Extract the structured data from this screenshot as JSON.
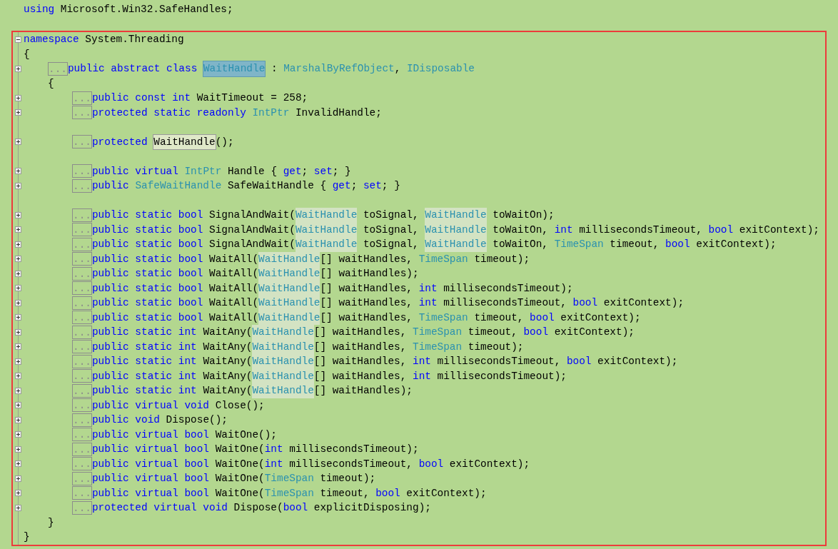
{
  "code": [
    {
      "kind": "code",
      "tokens": [
        {
          "text": "using ",
          "kind": "keyword"
        },
        {
          "text": "Microsoft.Win32.SafeHandles;",
          "kind": "plain"
        }
      ]
    },
    {
      "kind": "blank"
    }
  ],
  "annotated_code": [
    {
      "kind": "code",
      "collapsed": false,
      "tokens": [
        {
          "text": "namespace ",
          "kind": "keyword"
        },
        {
          "text": "System.Threading",
          "kind": "plain"
        }
      ],
      "open": "{",
      "close": "}",
      "children": [
        {
          "kind": "code",
          "collapsed": true,
          "ellipsis": "...",
          "tokens": [
            {
              "text": "public abstract class ",
              "kind": "keyword"
            },
            {
              "text": "WaitHandle",
              "kind": "type",
              "selected": true
            },
            {
              "text": " : ",
              "kind": "plain"
            },
            {
              "text": "MarshalByRefObject",
              "kind": "type"
            },
            {
              "text": ", ",
              "kind": "plain"
            },
            {
              "text": "IDisposable",
              "kind": "type"
            }
          ],
          "open": "{",
          "close": "}",
          "children": [
            {
              "kind": "code",
              "collapsed": true,
              "ellipsis": "...",
              "tokens": [
                {
                  "text": "public const int ",
                  "kind": "keyword"
                },
                {
                  "text": "WaitTimeout = 258;",
                  "kind": "plain"
                }
              ]
            },
            {
              "kind": "code",
              "collapsed": true,
              "ellipsis": "...",
              "tokens": [
                {
                  "text": "protected static readonly ",
                  "kind": "keyword"
                },
                {
                  "text": "IntPtr",
                  "kind": "type"
                },
                {
                  "text": " InvalidHandle;",
                  "kind": "plain"
                }
              ]
            },
            {
              "kind": "blank"
            },
            {
              "kind": "code",
              "collapsed": true,
              "ellipsis": "...",
              "tokens": [
                {
                  "text": "protected ",
                  "kind": "keyword"
                },
                {
                  "text": "WaitHandle",
                  "kind": "plain",
                  "boxed": true
                },
                {
                  "text": "();",
                  "kind": "plain"
                }
              ]
            },
            {
              "kind": "blank"
            },
            {
              "kind": "code",
              "collapsed": true,
              "ellipsis": "...",
              "tokens": [
                {
                  "text": "public virtual ",
                  "kind": "keyword"
                },
                {
                  "text": "IntPtr",
                  "kind": "type"
                },
                {
                  "text": " Handle { ",
                  "kind": "plain"
                },
                {
                  "text": "get",
                  "kind": "keyword"
                },
                {
                  "text": "; ",
                  "kind": "plain"
                },
                {
                  "text": "set",
                  "kind": "keyword"
                },
                {
                  "text": "; }",
                  "kind": "plain"
                }
              ]
            },
            {
              "kind": "code",
              "collapsed": true,
              "ellipsis": "...",
              "tokens": [
                {
                  "text": "public ",
                  "kind": "keyword"
                },
                {
                  "text": "SafeWaitHandle",
                  "kind": "type"
                },
                {
                  "text": " SafeWaitHandle { ",
                  "kind": "plain"
                },
                {
                  "text": "get",
                  "kind": "keyword"
                },
                {
                  "text": "; ",
                  "kind": "plain"
                },
                {
                  "text": "set",
                  "kind": "keyword"
                },
                {
                  "text": "; }",
                  "kind": "plain"
                }
              ]
            },
            {
              "kind": "blank"
            },
            {
              "kind": "code",
              "collapsed": true,
              "ellipsis": "...",
              "tokens": [
                {
                  "text": "public static bool ",
                  "kind": "keyword"
                },
                {
                  "text": "SignalAndWait(",
                  "kind": "plain"
                },
                {
                  "text": "WaitHandle",
                  "kind": "type",
                  "highlighted": true
                },
                {
                  "text": " toSignal, ",
                  "kind": "plain"
                },
                {
                  "text": "WaitHandle",
                  "kind": "type",
                  "highlighted": true
                },
                {
                  "text": " toWaitOn);",
                  "kind": "plain"
                }
              ]
            },
            {
              "kind": "code",
              "collapsed": true,
              "ellipsis": "...",
              "tokens": [
                {
                  "text": "public static bool ",
                  "kind": "keyword"
                },
                {
                  "text": "SignalAndWait(",
                  "kind": "plain"
                },
                {
                  "text": "WaitHandle",
                  "kind": "type",
                  "highlighted": true
                },
                {
                  "text": " toSignal, ",
                  "kind": "plain"
                },
                {
                  "text": "WaitHandle",
                  "kind": "type",
                  "highlighted": true
                },
                {
                  "text": " toWaitOn, ",
                  "kind": "plain"
                },
                {
                  "text": "int",
                  "kind": "keyword"
                },
                {
                  "text": " millisecondsTimeout, ",
                  "kind": "plain"
                },
                {
                  "text": "bool",
                  "kind": "keyword"
                },
                {
                  "text": " exitContext);",
                  "kind": "plain"
                }
              ]
            },
            {
              "kind": "code",
              "collapsed": true,
              "ellipsis": "...",
              "tokens": [
                {
                  "text": "public static bool ",
                  "kind": "keyword"
                },
                {
                  "text": "SignalAndWait(",
                  "kind": "plain"
                },
                {
                  "text": "WaitHandle",
                  "kind": "type",
                  "highlighted": true
                },
                {
                  "text": " toSignal, ",
                  "kind": "plain"
                },
                {
                  "text": "WaitHandle",
                  "kind": "type",
                  "highlighted": true
                },
                {
                  "text": " toWaitOn, ",
                  "kind": "plain"
                },
                {
                  "text": "TimeSpan",
                  "kind": "type"
                },
                {
                  "text": " timeout, ",
                  "kind": "plain"
                },
                {
                  "text": "bool",
                  "kind": "keyword"
                },
                {
                  "text": " exitContext);",
                  "kind": "plain"
                }
              ]
            },
            {
              "kind": "code",
              "collapsed": true,
              "ellipsis": "...",
              "tokens": [
                {
                  "text": "public static bool ",
                  "kind": "keyword"
                },
                {
                  "text": "WaitAll(",
                  "kind": "plain"
                },
                {
                  "text": "WaitHandle",
                  "kind": "type",
                  "highlighted": true
                },
                {
                  "text": "[] waitHandles, ",
                  "kind": "plain"
                },
                {
                  "text": "TimeSpan",
                  "kind": "type"
                },
                {
                  "text": " timeout);",
                  "kind": "plain"
                }
              ]
            },
            {
              "kind": "code",
              "collapsed": true,
              "ellipsis": "...",
              "tokens": [
                {
                  "text": "public static bool ",
                  "kind": "keyword"
                },
                {
                  "text": "WaitAll(",
                  "kind": "plain"
                },
                {
                  "text": "WaitHandle",
                  "kind": "type",
                  "highlighted": true
                },
                {
                  "text": "[] waitHandles);",
                  "kind": "plain"
                }
              ]
            },
            {
              "kind": "code",
              "collapsed": true,
              "ellipsis": "...",
              "tokens": [
                {
                  "text": "public static bool ",
                  "kind": "keyword"
                },
                {
                  "text": "WaitAll(",
                  "kind": "plain"
                },
                {
                  "text": "WaitHandle",
                  "kind": "type",
                  "highlighted": true
                },
                {
                  "text": "[] waitHandles, ",
                  "kind": "plain"
                },
                {
                  "text": "int",
                  "kind": "keyword"
                },
                {
                  "text": " millisecondsTimeout);",
                  "kind": "plain"
                }
              ]
            },
            {
              "kind": "code",
              "collapsed": true,
              "ellipsis": "...",
              "tokens": [
                {
                  "text": "public static bool ",
                  "kind": "keyword"
                },
                {
                  "text": "WaitAll(",
                  "kind": "plain"
                },
                {
                  "text": "WaitHandle",
                  "kind": "type",
                  "highlighted": true
                },
                {
                  "text": "[] waitHandles, ",
                  "kind": "plain"
                },
                {
                  "text": "int",
                  "kind": "keyword"
                },
                {
                  "text": " millisecondsTimeout, ",
                  "kind": "plain"
                },
                {
                  "text": "bool",
                  "kind": "keyword"
                },
                {
                  "text": " exitContext);",
                  "kind": "plain"
                }
              ]
            },
            {
              "kind": "code",
              "collapsed": true,
              "ellipsis": "...",
              "tokens": [
                {
                  "text": "public static bool ",
                  "kind": "keyword"
                },
                {
                  "text": "WaitAll(",
                  "kind": "plain"
                },
                {
                  "text": "WaitHandle",
                  "kind": "type",
                  "highlighted": true
                },
                {
                  "text": "[] waitHandles, ",
                  "kind": "plain"
                },
                {
                  "text": "TimeSpan",
                  "kind": "type"
                },
                {
                  "text": " timeout, ",
                  "kind": "plain"
                },
                {
                  "text": "bool",
                  "kind": "keyword"
                },
                {
                  "text": " exitContext);",
                  "kind": "plain"
                }
              ]
            },
            {
              "kind": "code",
              "collapsed": true,
              "ellipsis": "...",
              "tokens": [
                {
                  "text": "public static int ",
                  "kind": "keyword"
                },
                {
                  "text": "WaitAny(",
                  "kind": "plain"
                },
                {
                  "text": "WaitHandle",
                  "kind": "type",
                  "highlighted": true
                },
                {
                  "text": "[] waitHandles, ",
                  "kind": "plain"
                },
                {
                  "text": "TimeSpan",
                  "kind": "type"
                },
                {
                  "text": " timeout, ",
                  "kind": "plain"
                },
                {
                  "text": "bool",
                  "kind": "keyword"
                },
                {
                  "text": " exitContext);",
                  "kind": "plain"
                }
              ]
            },
            {
              "kind": "code",
              "collapsed": true,
              "ellipsis": "...",
              "tokens": [
                {
                  "text": "public static int ",
                  "kind": "keyword"
                },
                {
                  "text": "WaitAny(",
                  "kind": "plain"
                },
                {
                  "text": "WaitHandle",
                  "kind": "type",
                  "highlighted": true
                },
                {
                  "text": "[] waitHandles, ",
                  "kind": "plain"
                },
                {
                  "text": "TimeSpan",
                  "kind": "type"
                },
                {
                  "text": " timeout);",
                  "kind": "plain"
                }
              ]
            },
            {
              "kind": "code",
              "collapsed": true,
              "ellipsis": "...",
              "tokens": [
                {
                  "text": "public static int ",
                  "kind": "keyword"
                },
                {
                  "text": "WaitAny(",
                  "kind": "plain"
                },
                {
                  "text": "WaitHandle",
                  "kind": "type",
                  "highlighted": true
                },
                {
                  "text": "[] waitHandles, ",
                  "kind": "plain"
                },
                {
                  "text": "int",
                  "kind": "keyword"
                },
                {
                  "text": " millisecondsTimeout, ",
                  "kind": "plain"
                },
                {
                  "text": "bool",
                  "kind": "keyword"
                },
                {
                  "text": " exitContext);",
                  "kind": "plain"
                }
              ]
            },
            {
              "kind": "code",
              "collapsed": true,
              "ellipsis": "...",
              "tokens": [
                {
                  "text": "public static int ",
                  "kind": "keyword"
                },
                {
                  "text": "WaitAny(",
                  "kind": "plain"
                },
                {
                  "text": "WaitHandle",
                  "kind": "type",
                  "highlighted": true
                },
                {
                  "text": "[] waitHandles, ",
                  "kind": "plain"
                },
                {
                  "text": "int",
                  "kind": "keyword"
                },
                {
                  "text": " millisecondsTimeout);",
                  "kind": "plain"
                }
              ]
            },
            {
              "kind": "code",
              "collapsed": true,
              "ellipsis": "...",
              "tokens": [
                {
                  "text": "public static int ",
                  "kind": "keyword"
                },
                {
                  "text": "WaitAny(",
                  "kind": "plain"
                },
                {
                  "text": "WaitHandle",
                  "kind": "type",
                  "highlighted": true
                },
                {
                  "text": "[] waitHandles);",
                  "kind": "plain"
                }
              ]
            },
            {
              "kind": "code",
              "collapsed": true,
              "ellipsis": "...",
              "tokens": [
                {
                  "text": "public virtual void ",
                  "kind": "keyword"
                },
                {
                  "text": "Close();",
                  "kind": "plain"
                }
              ]
            },
            {
              "kind": "code",
              "collapsed": true,
              "ellipsis": "...",
              "tokens": [
                {
                  "text": "public void ",
                  "kind": "keyword"
                },
                {
                  "text": "Dispose();",
                  "kind": "plain"
                }
              ]
            },
            {
              "kind": "code",
              "collapsed": true,
              "ellipsis": "...",
              "tokens": [
                {
                  "text": "public virtual bool ",
                  "kind": "keyword"
                },
                {
                  "text": "WaitOne();",
                  "kind": "plain"
                }
              ]
            },
            {
              "kind": "code",
              "collapsed": true,
              "ellipsis": "...",
              "tokens": [
                {
                  "text": "public virtual bool ",
                  "kind": "keyword"
                },
                {
                  "text": "WaitOne(",
                  "kind": "plain"
                },
                {
                  "text": "int",
                  "kind": "keyword"
                },
                {
                  "text": " millisecondsTimeout);",
                  "kind": "plain"
                }
              ]
            },
            {
              "kind": "code",
              "collapsed": true,
              "ellipsis": "...",
              "tokens": [
                {
                  "text": "public virtual bool ",
                  "kind": "keyword"
                },
                {
                  "text": "WaitOne(",
                  "kind": "plain"
                },
                {
                  "text": "int",
                  "kind": "keyword"
                },
                {
                  "text": " millisecondsTimeout, ",
                  "kind": "plain"
                },
                {
                  "text": "bool",
                  "kind": "keyword"
                },
                {
                  "text": " exitContext);",
                  "kind": "plain"
                }
              ]
            },
            {
              "kind": "code",
              "collapsed": true,
              "ellipsis": "...",
              "tokens": [
                {
                  "text": "public virtual bool ",
                  "kind": "keyword"
                },
                {
                  "text": "WaitOne(",
                  "kind": "plain"
                },
                {
                  "text": "TimeSpan",
                  "kind": "type"
                },
                {
                  "text": " timeout);",
                  "kind": "plain"
                }
              ]
            },
            {
              "kind": "code",
              "collapsed": true,
              "ellipsis": "...",
              "tokens": [
                {
                  "text": "public virtual bool ",
                  "kind": "keyword"
                },
                {
                  "text": "WaitOne(",
                  "kind": "plain"
                },
                {
                  "text": "TimeSpan",
                  "kind": "type"
                },
                {
                  "text": " timeout, ",
                  "kind": "plain"
                },
                {
                  "text": "bool",
                  "kind": "keyword"
                },
                {
                  "text": " exitContext);",
                  "kind": "plain"
                }
              ]
            },
            {
              "kind": "code",
              "collapsed": true,
              "ellipsis": "...",
              "tokens": [
                {
                  "text": "protected virtual void ",
                  "kind": "keyword"
                },
                {
                  "text": "Dispose(",
                  "kind": "plain"
                },
                {
                  "text": "bool",
                  "kind": "keyword"
                },
                {
                  "text": " explicitDisposing);",
                  "kind": "plain"
                }
              ]
            }
          ]
        }
      ]
    }
  ]
}
